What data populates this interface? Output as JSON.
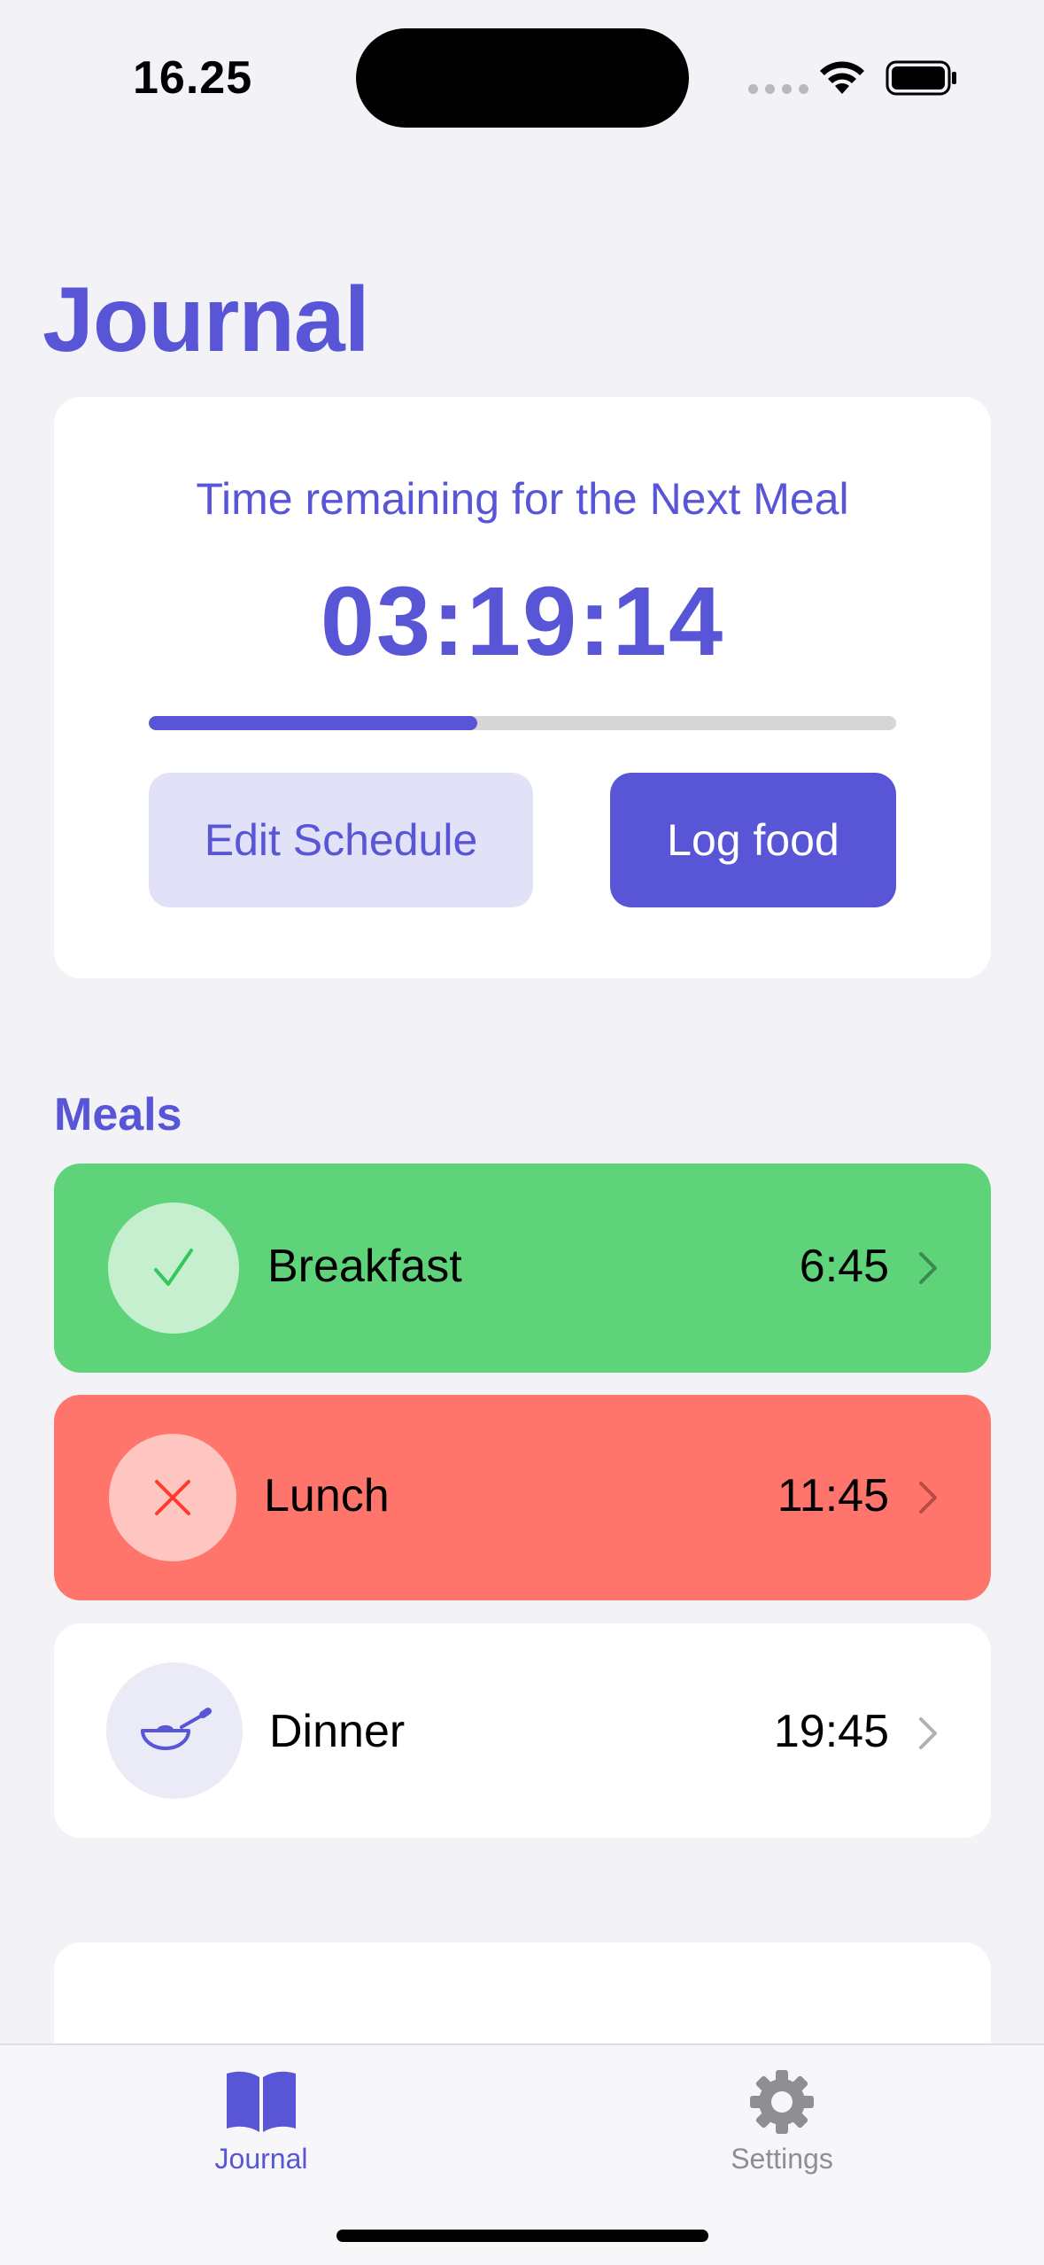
{
  "status_bar": {
    "time": "16.25"
  },
  "page": {
    "title": "Journal"
  },
  "timer_card": {
    "caption": "Time remaining for the Next Meal",
    "remaining": "03:19:14",
    "progress_fraction": 0.44,
    "edit_label": "Edit Schedule",
    "log_label": "Log food"
  },
  "meals": {
    "section_title": "Meals",
    "items": [
      {
        "name": "Breakfast",
        "time": "6:45",
        "status": "done",
        "icon": "checkmark-icon"
      },
      {
        "name": "Lunch",
        "time": "11:45",
        "status": "missed",
        "icon": "xmark-icon"
      },
      {
        "name": "Dinner",
        "time": "19:45",
        "status": "upcoming",
        "icon": "bowl-icon"
      }
    ]
  },
  "tabbar": {
    "tabs": [
      {
        "label": "Journal",
        "icon": "book-icon",
        "selected": true
      },
      {
        "label": "Settings",
        "icon": "gear-icon",
        "selected": false
      }
    ]
  },
  "colors": {
    "accent": "#5856d6",
    "success": "#5fd37a",
    "danger": "#ff756b",
    "background": "#f2f2f7"
  }
}
